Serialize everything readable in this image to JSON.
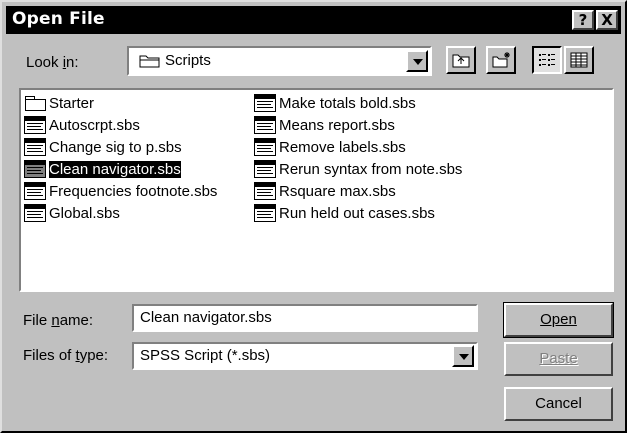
{
  "dialog": {
    "title": "Open File",
    "help_glyph": "?",
    "close_glyph": "X"
  },
  "look_in": {
    "label": "Look in:",
    "label_underline_char": "i",
    "value": "Scripts"
  },
  "toolbar": {
    "up_one_level": "up-folder-icon",
    "new_folder": "new-folder-icon",
    "list_view": "list-view-icon",
    "details_view": "details-view-icon"
  },
  "files": [
    {
      "name": "Starter",
      "type": "folder"
    },
    {
      "name": "Autoscrpt.sbs",
      "type": "script"
    },
    {
      "name": "Change sig to p.sbs",
      "type": "script"
    },
    {
      "name": "Clean navigator.sbs",
      "type": "script",
      "selected": true
    },
    {
      "name": "Frequencies footnote.sbs",
      "type": "script"
    },
    {
      "name": "Global.sbs",
      "type": "script"
    },
    {
      "name": "Make totals bold.sbs",
      "type": "script"
    },
    {
      "name": "Means report.sbs",
      "type": "script"
    },
    {
      "name": "Remove labels.sbs",
      "type": "script"
    },
    {
      "name": "Rerun syntax from note.sbs",
      "type": "script"
    },
    {
      "name": "Rsquare max.sbs",
      "type": "script"
    },
    {
      "name": "Run held out cases.sbs",
      "type": "script"
    }
  ],
  "file_name": {
    "label": "File name:",
    "value": "Clean navigator.sbs"
  },
  "file_type": {
    "label": "Files of type:",
    "value": "SPSS Script (*.sbs)"
  },
  "buttons": {
    "open": "Open",
    "paste": "Paste",
    "cancel": "Cancel"
  }
}
